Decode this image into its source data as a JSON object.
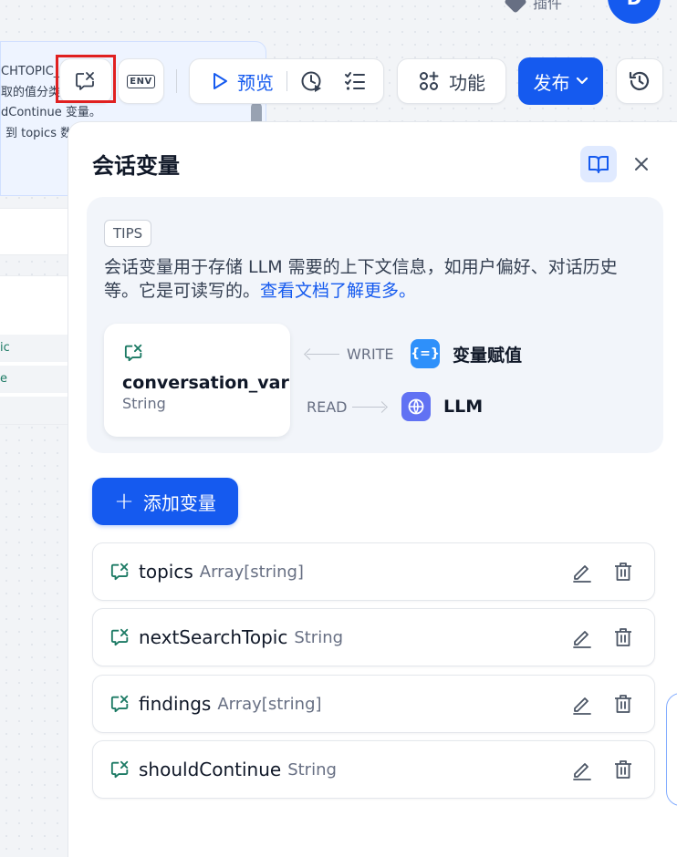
{
  "header": {
    "plugin_label": "插件",
    "avatar_letter": "D"
  },
  "canvas": {
    "node_lines": [
      "CHTOPIC_EXT",
      "取的值分类",
      "dContinue 变量。",
      "到 topics 数"
    ],
    "rows": [
      "ic",
      "e",
      ""
    ]
  },
  "toolbar": {
    "env_label": "ENV",
    "preview_label": "预览",
    "features_label": "功能",
    "publish_label": "发布"
  },
  "panel": {
    "title": "会话变量",
    "tips_badge": "TIPS",
    "tips_text": "会话变量用于存储 LLM 需要的上下文信息，如用户偏好、对话历史等。它是可读写的。",
    "tips_link": "查看文档了解更多。",
    "example": {
      "name": "conversation_var",
      "type": "String",
      "write_label": "WRITE",
      "write_target": "变量赋值",
      "read_label": "READ",
      "read_target": "LLM"
    },
    "add_button": "添加变量",
    "variables": [
      {
        "name": "topics",
        "type": "Array[string]"
      },
      {
        "name": "nextSearchTopic",
        "type": "String"
      },
      {
        "name": "findings",
        "type": "Array[string]"
      },
      {
        "name": "shouldContinue",
        "type": "String"
      }
    ]
  },
  "colors": {
    "accent": "#155aef",
    "var_icon": "#1c7a64",
    "highlight": "#e02020"
  }
}
